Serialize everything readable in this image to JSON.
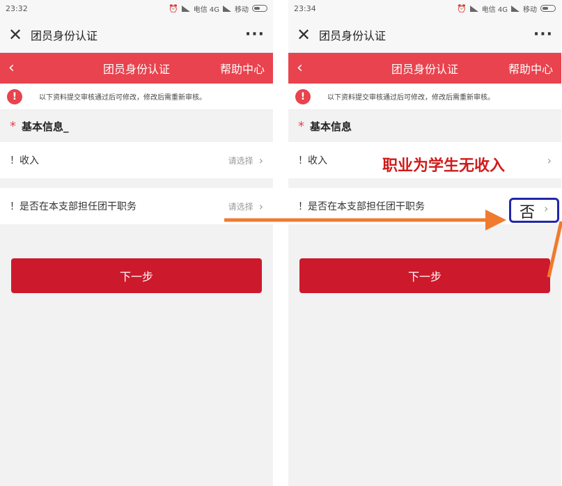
{
  "screens": [
    {
      "status": {
        "time": "23:32",
        "carrier": "电信 4G",
        "carrier2": "移动"
      },
      "wechat": {
        "title": "团员身份认证"
      },
      "header": {
        "title": "团员身份认证",
        "help": "帮助中心"
      },
      "notice": "以下资料提交审核通过后可修改，修改后需重新审核。",
      "section": {
        "star": "*",
        "title": "基本信息_"
      },
      "rows": [
        {
          "label": "！收入",
          "value": "请选择"
        },
        {
          "label": "！是否在本支部担任团干职务",
          "value": "请选择"
        }
      ],
      "next": "下一步"
    },
    {
      "status": {
        "time": "23:34",
        "carrier": "电信 4G",
        "carrier2": "移动"
      },
      "wechat": {
        "title": "团员身份认证"
      },
      "header": {
        "title": "团员身份认证",
        "help": "帮助中心"
      },
      "notice": "以下资料提交审核通过后可修改，修改后需重新审核。",
      "section": {
        "star": "*",
        "title": "基本信息"
      },
      "rows": [
        {
          "label": "！收入",
          "value": ""
        },
        {
          "label": "！是否在本支部担任团干职务",
          "value": ""
        }
      ],
      "next": "下一步"
    }
  ],
  "annotations": {
    "income_note": "职业为学生无收入",
    "selected": "否"
  },
  "icons": {
    "close": "close-icon",
    "more": "more-icon",
    "back": "chevron-left-icon",
    "chevron": "chevron-right-icon",
    "alert": "alert-icon"
  },
  "colors": {
    "header": "#e8434e",
    "button": "#cc1a2c",
    "annotation_text": "#d11a1a",
    "annotation_box": "#2127a8",
    "arrow": "#f07a2e"
  }
}
